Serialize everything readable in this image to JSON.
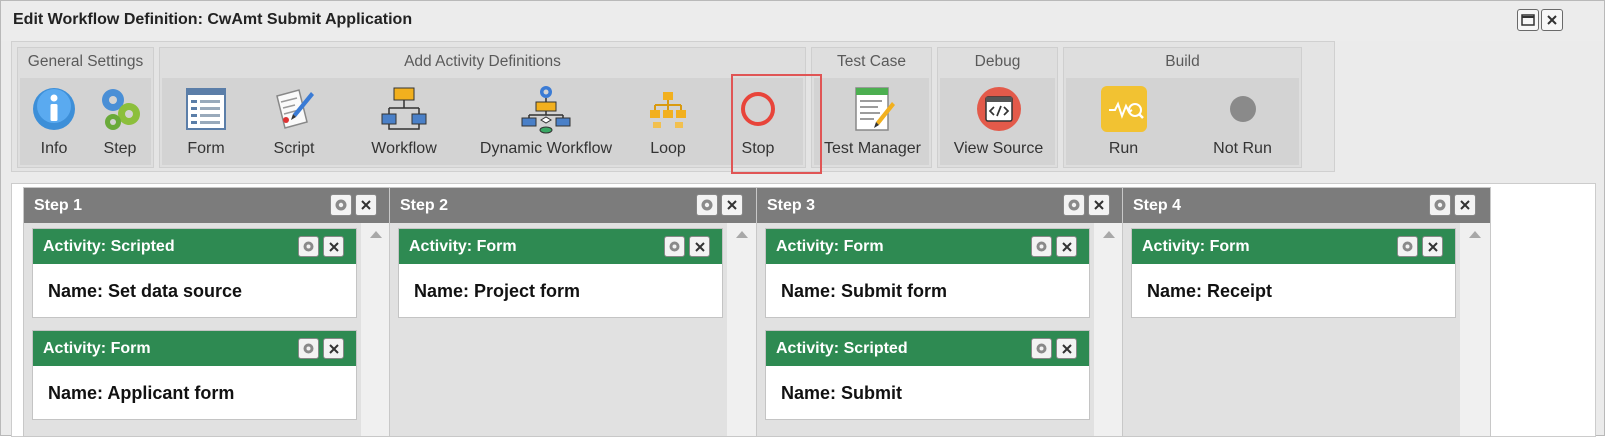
{
  "window": {
    "title": "Edit Workflow Definition: CwAmt Submit Application"
  },
  "ribbon": {
    "groups": [
      {
        "label": "General Settings"
      },
      {
        "label": "Add Activity Definitions"
      },
      {
        "label": "Test Case"
      },
      {
        "label": "Debug"
      },
      {
        "label": "Build"
      }
    ],
    "tools": {
      "info": {
        "label": "Info",
        "icon": "info-icon"
      },
      "step": {
        "label": "Step",
        "icon": "gears-icon"
      },
      "form": {
        "label": "Form",
        "icon": "form-icon"
      },
      "script": {
        "label": "Script",
        "icon": "script-icon"
      },
      "workflow": {
        "label": "Workflow",
        "icon": "workflow-icon"
      },
      "dynamic_workflow": {
        "label": "Dynamic Workflow",
        "icon": "dynamic-workflow-icon"
      },
      "loop": {
        "label": "Loop",
        "icon": "loop-icon"
      },
      "stop": {
        "label": "Stop",
        "icon": "stop-icon"
      },
      "test_manager": {
        "label": "Test Manager",
        "icon": "test-manager-icon"
      },
      "view_source": {
        "label": "View Source",
        "icon": "view-source-icon"
      },
      "run": {
        "label": "Run",
        "icon": "run-icon"
      },
      "not_run": {
        "label": "Not Run",
        "icon": "status-dot-icon"
      }
    }
  },
  "steps": [
    {
      "title": "Step 1",
      "activities": [
        {
          "title": "Activity: Scripted",
          "name": "Name: Set data source"
        },
        {
          "title": "Activity: Form",
          "name": "Name: Applicant form"
        }
      ]
    },
    {
      "title": "Step 2",
      "activities": [
        {
          "title": "Activity: Form",
          "name": "Name: Project form"
        }
      ]
    },
    {
      "title": "Step 3",
      "activities": [
        {
          "title": "Activity: Form",
          "name": "Name: Submit form"
        },
        {
          "title": "Activity: Scripted",
          "name": "Name: Submit"
        }
      ]
    },
    {
      "title": "Step 4",
      "activities": [
        {
          "title": "Activity: Form",
          "name": "Name: Receipt"
        }
      ]
    }
  ],
  "colors": {
    "activity_header": "#2e8a52",
    "step_header": "#7c7c7c",
    "highlight": "#e05555"
  }
}
